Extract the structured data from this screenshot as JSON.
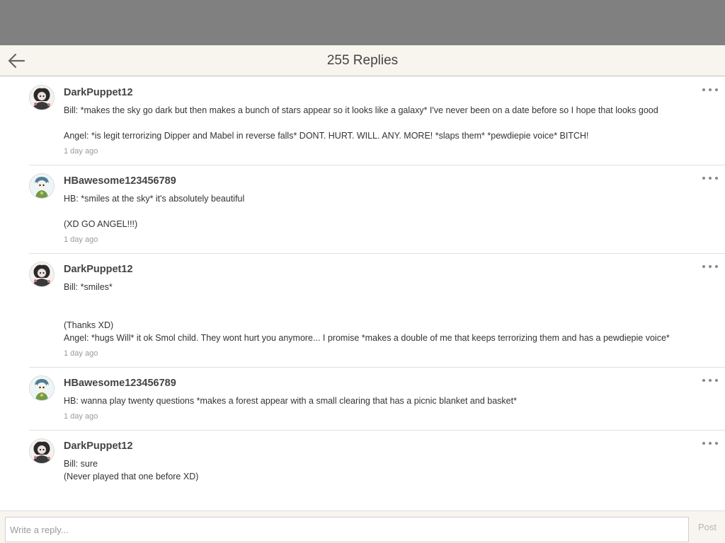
{
  "header": {
    "title": "255 Replies",
    "back_icon": "arrow-left-icon"
  },
  "comments": [
    {
      "username": "DarkPuppet12",
      "avatar": "avatar-darkpuppet",
      "lines": [
        "Bill: *makes the sky go dark but then makes a bunch of stars appear so it looks like a galaxy* I've never been on a date before so I hope that looks good",
        "",
        "Angel: *is legit terrorizing Dipper and Mabel in reverse falls* DONT. HURT. WILL. ANY. MORE! *slaps them* *pewdiepie voice* BITCH!"
      ],
      "timestamp": "1 day ago"
    },
    {
      "username": "HBawesome123456789",
      "avatar": "avatar-hbawesome",
      "lines": [
        "HB: *smiles at the sky* it's absolutely beautiful",
        "",
        "(XD GO ANGEL!!!)"
      ],
      "timestamp": "1 day ago"
    },
    {
      "username": "DarkPuppet12",
      "avatar": "avatar-darkpuppet",
      "lines": [
        "Bill: *smiles*",
        "",
        "",
        "(Thanks XD)",
        "Angel: *hugs Will* it ok Smol child. They wont hurt you anymore... I promise *makes a double of me that keeps terrorizing them and has a pewdiepie voice*"
      ],
      "timestamp": "1 day ago"
    },
    {
      "username": "HBawesome123456789",
      "avatar": "avatar-hbawesome",
      "lines": [
        "HB: wanna play twenty questions *makes a forest appear with a small clearing that has a picnic blanket and basket*"
      ],
      "timestamp": "1 day ago"
    },
    {
      "username": "DarkPuppet12",
      "avatar": "avatar-darkpuppet",
      "lines": [
        "Bill: sure",
        "(Never played that one before XD)"
      ],
      "timestamp": ""
    }
  ],
  "composer": {
    "placeholder": "Write a reply...",
    "value": "",
    "post_label": "Post"
  },
  "colors": {
    "header_bg": "#f7f5ee",
    "status_strip": "#808080",
    "text": "#333333",
    "muted": "#9a9a9a",
    "divider": "#e0e0e0"
  }
}
